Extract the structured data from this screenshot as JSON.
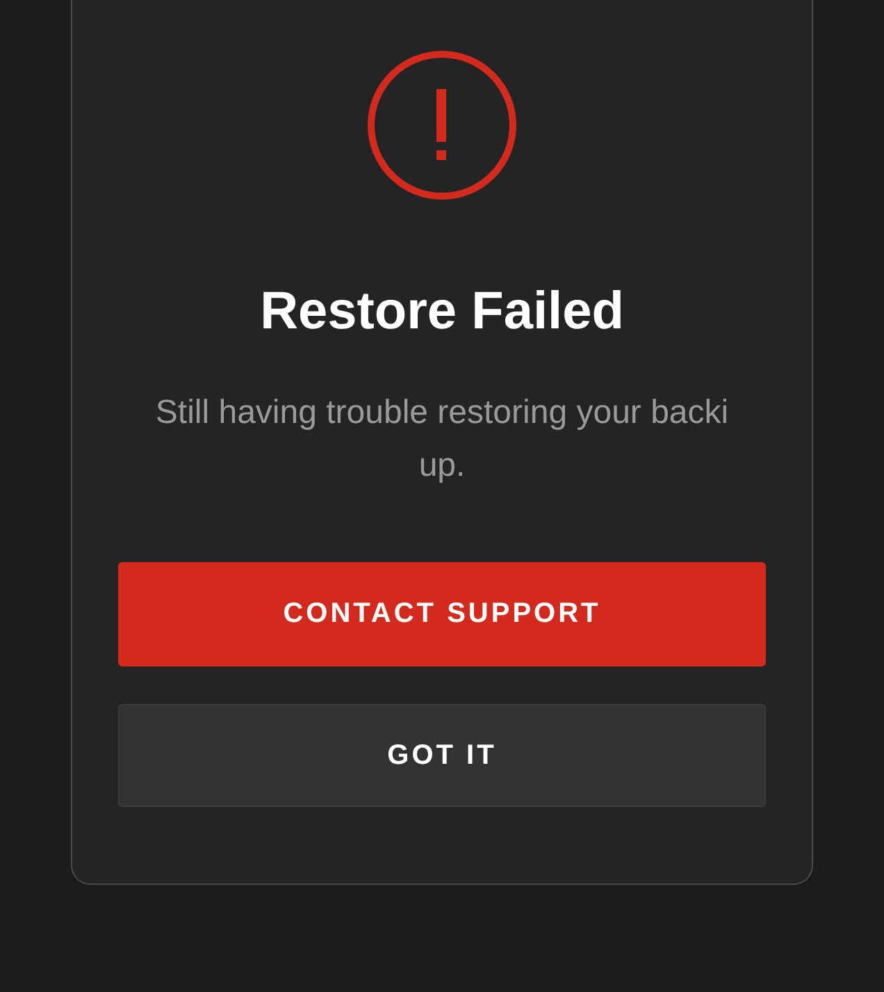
{
  "dialog": {
    "title": "Restore Failed",
    "message": "Still having trouble restoring your backi up.",
    "buttons": [
      {
        "label": "CONTACT SUPPORT",
        "kind": "primary"
      },
      {
        "label": "GOT IT",
        "kind": "secondary"
      }
    ]
  }
}
